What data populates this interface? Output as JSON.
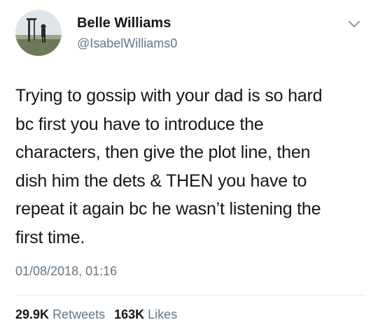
{
  "author": {
    "name": "Belle Williams",
    "handle": "@IsabelWilliams0",
    "avatar_icon": "profile-photo"
  },
  "tweet": {
    "lines": [
      "Trying to gossip with your dad is so hard",
      "bc first you have to introduce the",
      "characters, then give the plot line, then",
      "dish him the dets & THEN you have to",
      "repeat it again bc he wasn’t listening the",
      "first time."
    ],
    "timestamp": "01/08/2018, 01:16"
  },
  "stats": {
    "retweets_count": "29.9K",
    "retweets_label": "Retweets",
    "likes_count": "163K",
    "likes_label": "Likes"
  },
  "menu_icon": "chevron-down-icon",
  "colors": {
    "text": "#14171a",
    "secondary": "#657786",
    "divider": "#e6ecf0"
  }
}
